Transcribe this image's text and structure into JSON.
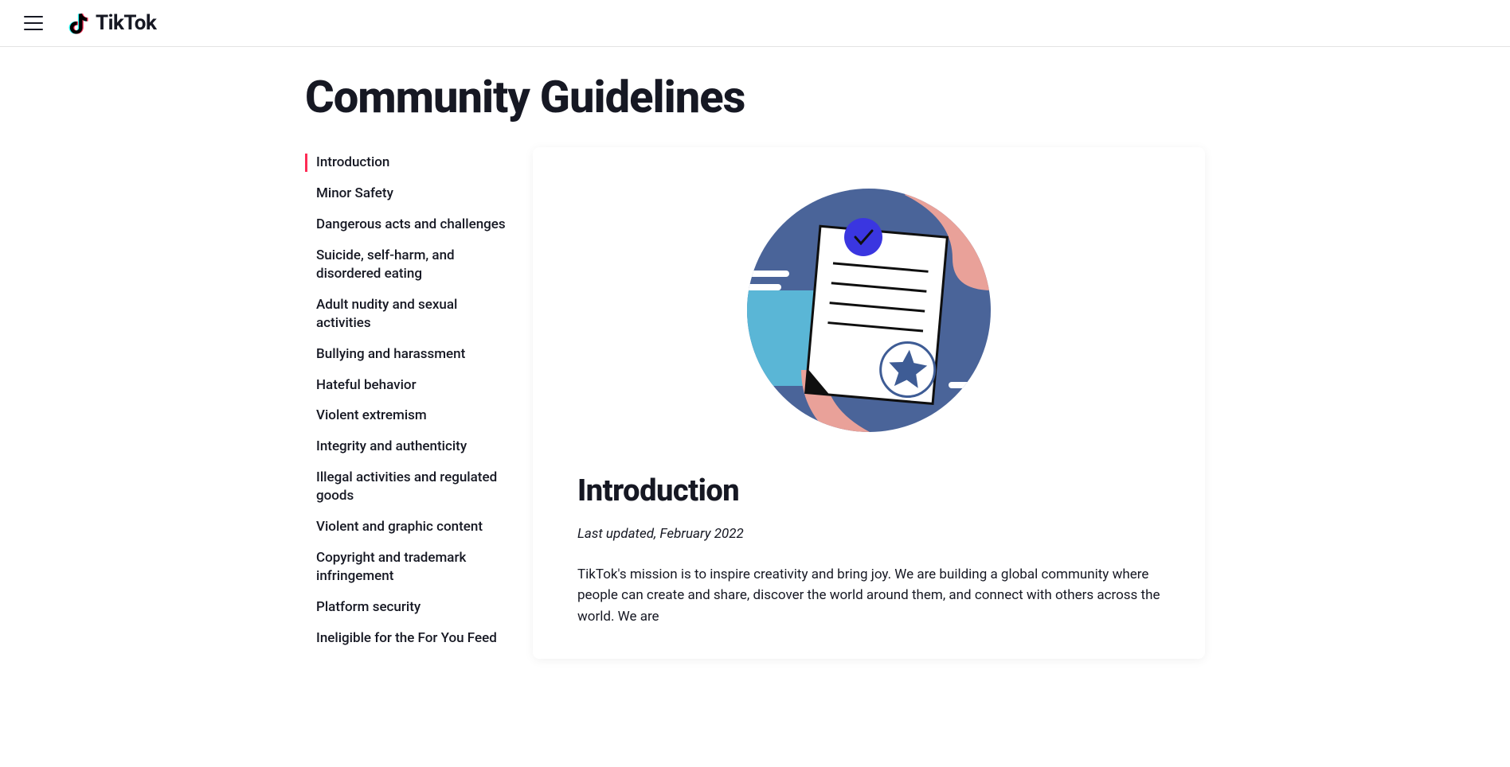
{
  "header": {
    "brand": "TikTok"
  },
  "page": {
    "title": "Community Guidelines"
  },
  "sidebar": {
    "items": [
      {
        "label": "Introduction",
        "active": true
      },
      {
        "label": "Minor Safety",
        "active": false
      },
      {
        "label": "Dangerous acts and challenges",
        "active": false
      },
      {
        "label": "Suicide, self-harm, and disordered eating",
        "active": false
      },
      {
        "label": "Adult nudity and sexual activities",
        "active": false
      },
      {
        "label": "Bullying and harassment",
        "active": false
      },
      {
        "label": "Hateful behavior",
        "active": false
      },
      {
        "label": "Violent extremism",
        "active": false
      },
      {
        "label": "Integrity and authenticity",
        "active": false
      },
      {
        "label": "Illegal activities and regulated goods",
        "active": false
      },
      {
        "label": "Violent and graphic content",
        "active": false
      },
      {
        "label": "Copyright and trademark infringement",
        "active": false
      },
      {
        "label": "Platform security",
        "active": false
      },
      {
        "label": "Ineligible for the For You Feed",
        "active": false
      }
    ]
  },
  "article": {
    "heading": "Introduction",
    "last_updated": "Last updated, February 2022",
    "body": "TikTok's mission is to inspire creativity and bring joy. We are building a global community where people can create and share, discover the world around them, and connect with others across the world. We are"
  }
}
